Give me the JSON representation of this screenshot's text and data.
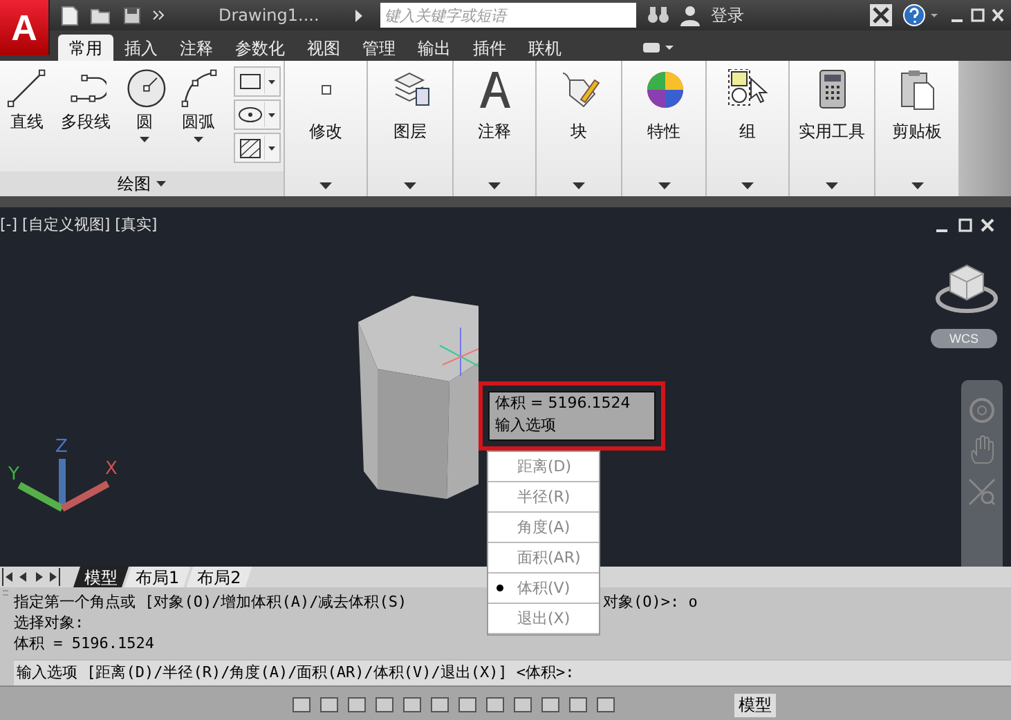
{
  "title_bar": {
    "logo": "A",
    "file_name": "Drawing1....",
    "search": {
      "placeholder": "键入关键字或短语"
    },
    "sign_in": "登录"
  },
  "ribbon_tabs": [
    {
      "label": "常用",
      "selected": true
    },
    {
      "label": "插入",
      "selected": false
    },
    {
      "label": "注释",
      "selected": false
    },
    {
      "label": "参数化",
      "selected": false
    },
    {
      "label": "视图",
      "selected": false
    },
    {
      "label": "管理",
      "selected": false
    },
    {
      "label": "输出",
      "selected": false
    },
    {
      "label": "插件",
      "selected": false
    },
    {
      "label": "联机",
      "selected": false
    }
  ],
  "draw_panel": {
    "title": "绘图",
    "tools": [
      {
        "label": "直线",
        "kind": "line",
        "dropdown": false
      },
      {
        "label": "多段线",
        "kind": "polyline",
        "dropdown": false
      },
      {
        "label": "圆",
        "kind": "circle",
        "dropdown": true
      },
      {
        "label": "圆弧",
        "kind": "arc",
        "dropdown": true
      }
    ]
  },
  "panels": [
    {
      "label": "修改",
      "kind": "modify"
    },
    {
      "label": "图层",
      "kind": "layers"
    },
    {
      "label": "注释",
      "kind": "annotate"
    },
    {
      "label": "块",
      "kind": "block"
    },
    {
      "label": "特性",
      "kind": "properties"
    },
    {
      "label": "组",
      "kind": "group"
    },
    {
      "label": "实用工具",
      "kind": "utilities"
    },
    {
      "label": "剪贴板",
      "kind": "clipboard"
    }
  ],
  "viewport": {
    "label": "[-] [自定义视图] [真实]",
    "view_cube_label": "WCS",
    "axes": {
      "x": "X",
      "y": "Y",
      "z": "Z"
    },
    "tooltip": [
      "体积 = 5196.1524",
      "输入选项"
    ],
    "option_menu": [
      {
        "label": "距离(D)",
        "selected": false
      },
      {
        "label": "半径(R)",
        "selected": false
      },
      {
        "label": "角度(A)",
        "selected": false
      },
      {
        "label": "面积(AR)",
        "selected": false
      },
      {
        "label": "体积(V)",
        "selected": true
      },
      {
        "label": "退出(X)",
        "selected": false
      }
    ]
  },
  "layout_tabs": [
    {
      "label": "模型",
      "selected": true
    },
    {
      "label": "布局1",
      "selected": false
    },
    {
      "label": "布局2",
      "selected": false
    }
  ],
  "command_history": [
    [
      "指定第一个角点或 [对象(O)/增加体积(A)/减去体积(S)",
      "对象(O)>: o"
    ],
    [
      "选择对象:"
    ],
    [
      "体积 = 5196.1524"
    ]
  ],
  "command_prompt": "输入选项 [距离(D)/半径(R)/角度(A)/面积(AR)/体积(V)/退出(X)] <体积>:",
  "status_bar": {
    "space": "模型"
  }
}
